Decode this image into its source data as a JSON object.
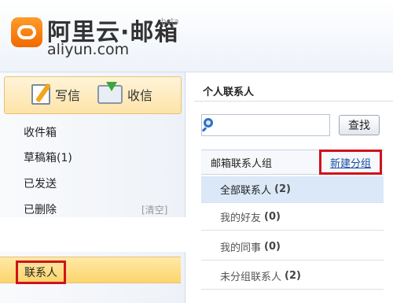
{
  "header": {
    "brand_cn": "阿里云·邮箱",
    "brand_beta": "beta",
    "brand_en": "aliyun.com"
  },
  "toolbar": {
    "write_label": "写信",
    "inbox_label": "收信"
  },
  "sidebar": {
    "items": [
      {
        "label": "收件箱"
      },
      {
        "label": "草稿箱(1)"
      },
      {
        "label": "已发送"
      },
      {
        "label": "已删除"
      }
    ],
    "clear_label": "[清空]",
    "contacts_label": "联系人"
  },
  "main": {
    "title": "个人联系人",
    "search": {
      "placeholder": "",
      "button_label": "查找"
    },
    "groups_title": "邮箱联系人组",
    "new_group_label": "新建分组",
    "groups": [
      {
        "name": "全部联系人",
        "count": "(2)"
      },
      {
        "name": "我的好友",
        "count": "(0)"
      },
      {
        "name": "我的同事",
        "count": "(0)"
      },
      {
        "name": "未分组联系人",
        "count": "(2)"
      }
    ]
  },
  "colors": {
    "accent_orange": "#f06a00",
    "highlight_red": "#d0121b",
    "link_blue": "#1b4fa5",
    "selected_row": "#dbe8f7"
  }
}
